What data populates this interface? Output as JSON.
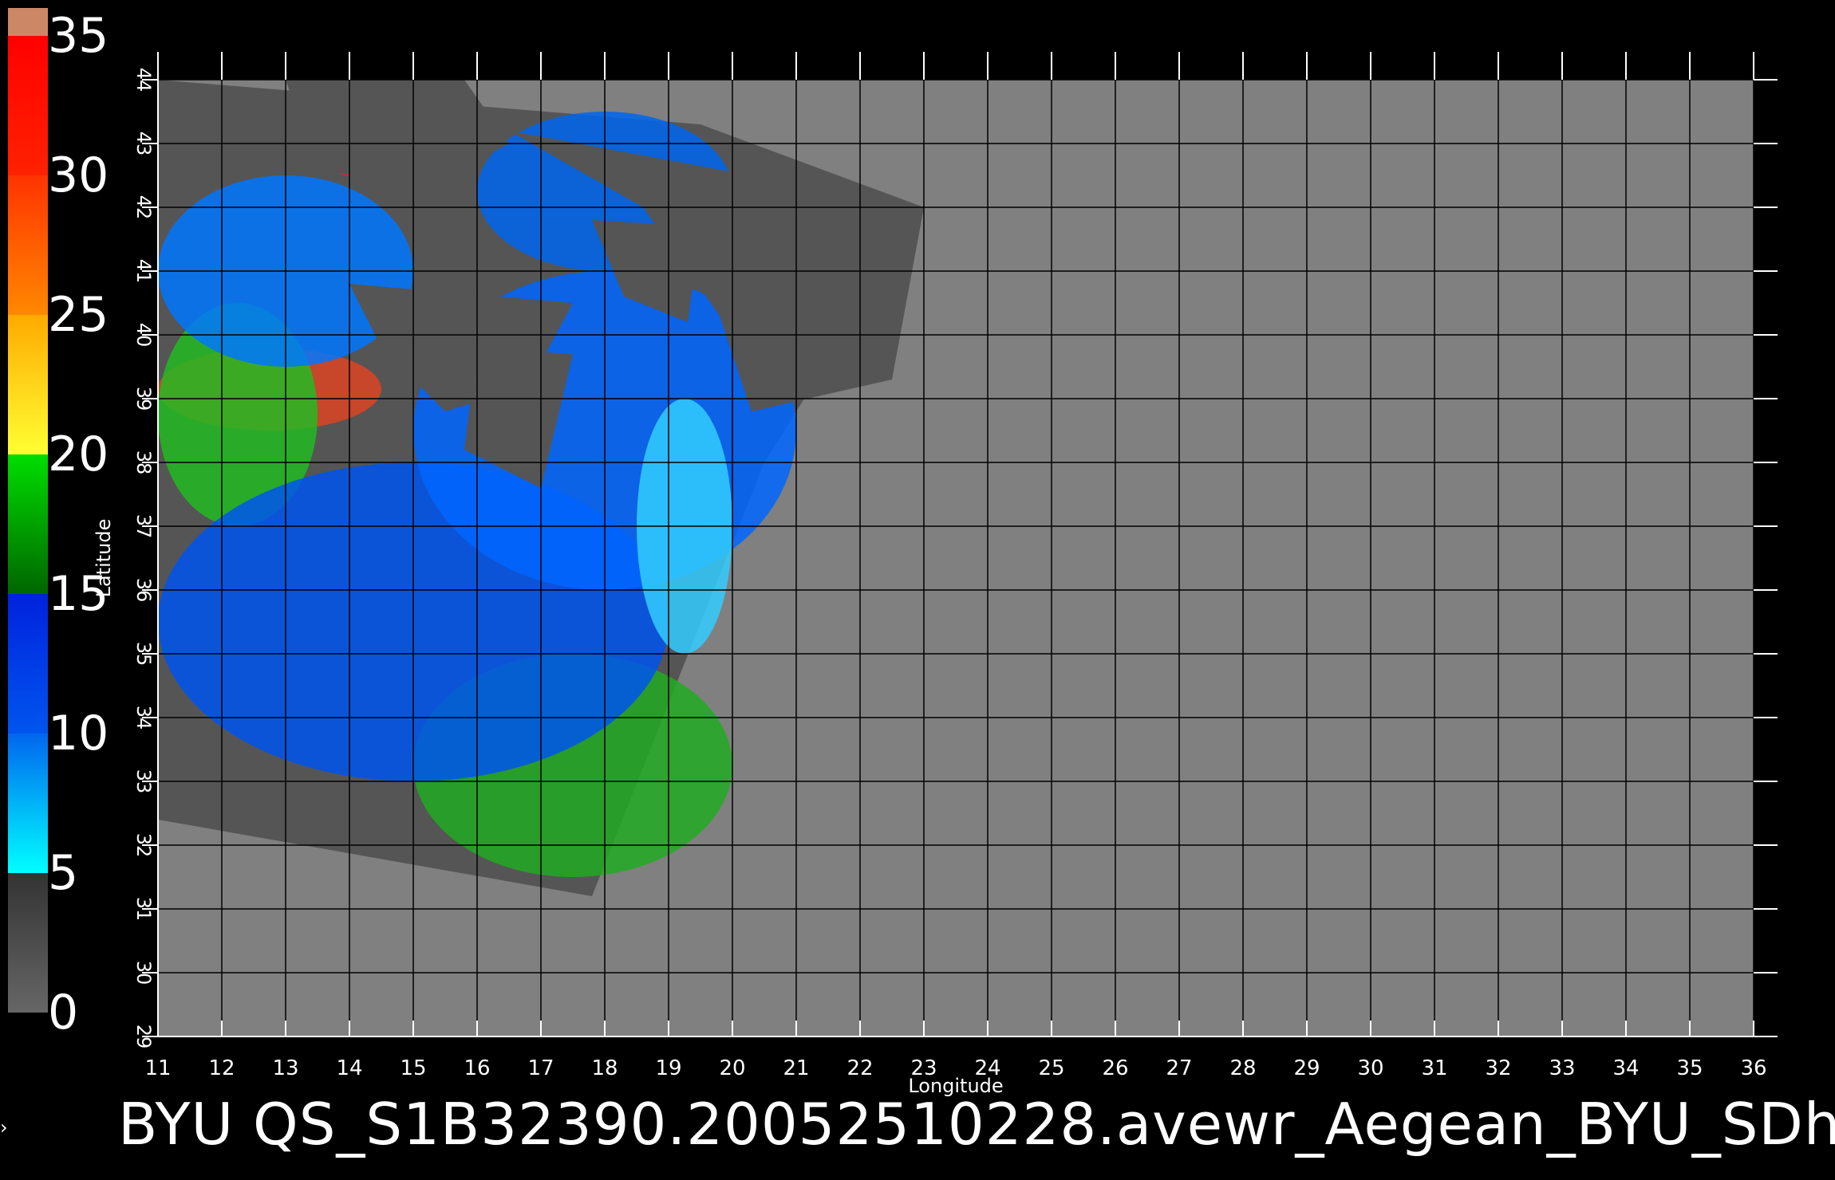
{
  "colorbar": {
    "min": 0,
    "max": 35,
    "ticks": [
      "0",
      "5",
      "10",
      "15",
      "20",
      "25",
      "30",
      "35"
    ],
    "bands": [
      {
        "from": 0,
        "to": 5,
        "colors": [
          "#666666",
          "#333333"
        ]
      },
      {
        "from": 5,
        "to": 10,
        "colors": [
          "#00ffff",
          "#0066ee"
        ]
      },
      {
        "from": 10,
        "to": 15,
        "colors": [
          "#0055ee",
          "#0022dd"
        ]
      },
      {
        "from": 15,
        "to": 20,
        "colors": [
          "#006600",
          "#00dd00"
        ]
      },
      {
        "from": 20,
        "to": 25,
        "colors": [
          "#ffff33",
          "#ffaa00"
        ]
      },
      {
        "from": 25,
        "to": 30,
        "colors": [
          "#ff8800",
          "#ff3300"
        ]
      },
      {
        "from": 30,
        "to": 35,
        "colors": [
          "#ff2200",
          "#ff0000"
        ]
      },
      {
        "from": 35,
        "to": 36,
        "colors": [
          "#cc8866",
          "#cc8866"
        ]
      }
    ]
  },
  "map": {
    "lon_range": [
      11,
      36
    ],
    "lat_range": [
      29,
      44
    ],
    "lon_ticks": [
      "11",
      "12",
      "13",
      "14",
      "15",
      "16",
      "17",
      "18",
      "19",
      "20",
      "21",
      "22",
      "23",
      "24",
      "25",
      "26",
      "27",
      "28",
      "29",
      "30",
      "31",
      "32",
      "33",
      "34",
      "35",
      "36"
    ],
    "lat_ticks": [
      "29",
      "30",
      "31",
      "32",
      "33",
      "34",
      "35",
      "36",
      "37",
      "38",
      "39",
      "40",
      "41",
      "42",
      "43",
      "44"
    ],
    "x_label": "Longitude",
    "y_label": "Latitude",
    "background_color": "#808080",
    "swath_color": "#555555",
    "swath_corners_lonlat": [
      [
        11,
        44
      ],
      [
        19.5,
        43.3
      ],
      [
        23,
        42
      ],
      [
        20.5,
        38
      ],
      [
        17.8,
        31.2
      ],
      [
        11,
        32.4
      ]
    ]
  },
  "colors": {
    "grid": "#000000",
    "tick": "#ffffff",
    "land": "#555555"
  },
  "footer": {
    "filename": "BYU  QS_S1B32390.20052510228.avewr_Aegean_BYU_SDh"
  }
}
